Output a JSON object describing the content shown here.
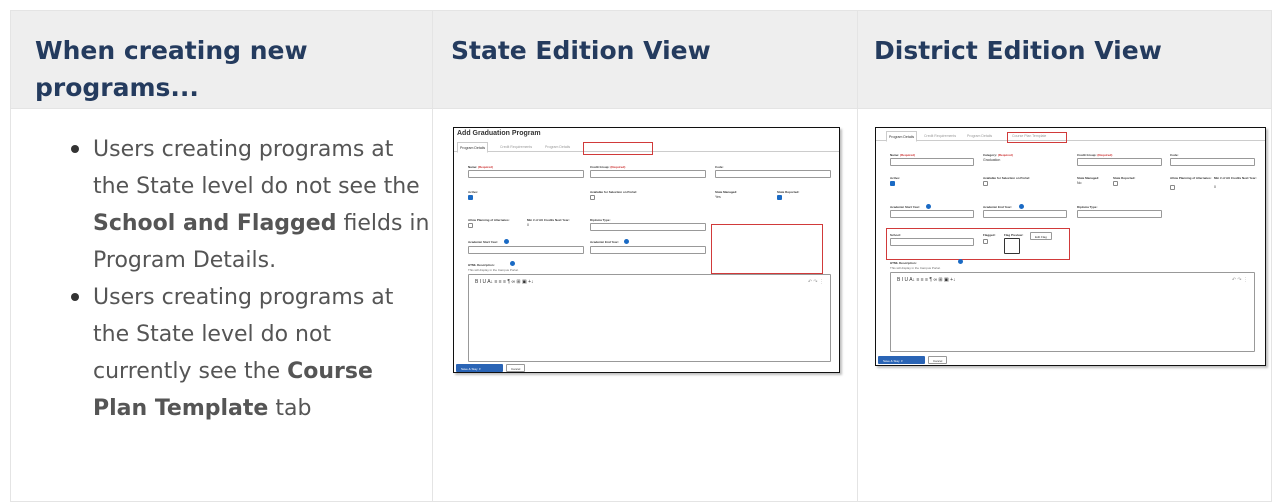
{
  "headers": {
    "col1": "When creating new programs...",
    "col2": "State Edition View",
    "col3": "District Edition View"
  },
  "bullets": [
    {
      "before": "Users creating programs at the State level do not see the ",
      "bold": "School and Flagged",
      "after": " fields in Program Details."
    },
    {
      "before": "Users creating programs at the State level do not currently see the ",
      "bold": "Course Plan Template",
      "after": " tab"
    }
  ],
  "state_shot": {
    "title": "Add Graduation Program",
    "tabs": [
      "Program Details",
      "Credit Requirements",
      "Program Details"
    ],
    "required": "(Required)",
    "name_label": "Name:",
    "credit_group_label": "Credit Group:",
    "code_label": "Code:",
    "active_label": "Active:",
    "available_label": "Available for Selection on Portal:",
    "state_managed_label": "State Managed:",
    "state_managed_value": "Yes",
    "state_reported_label": "State Reported:",
    "allow_planning_label": "Allow Planning of Alternates:",
    "min_credits_label": "Min # of Alt Credits Next Year:",
    "min_credits_value": "0",
    "diploma_type_label": "Diploma Type:",
    "start_year_label": "Academic Start Year:",
    "end_year_label": "Academic End Year:",
    "html_desc_label": "HTML Description:",
    "html_desc_note": "This will display in the Campus Portal.",
    "toolbar": "B   I   U   A↓    ≡  ≡  ≡  ¶    ∞  ⊞  ▣  +↓",
    "undo": "↶  ↷  ⋮",
    "save_label": "Save & Stay",
    "cancel_label": "Cancel"
  },
  "district_shot": {
    "tabs": [
      "Program Details",
      "Credit Requirements",
      "Program Details",
      "Course Plan Template"
    ],
    "required": "(Required)",
    "name_label": "Name:",
    "category_label": "Category:",
    "category_value": "Graduation",
    "credit_group_label": "Credit Group:",
    "code_label": "Code:",
    "active_label": "Active:",
    "available_label": "Available for Selection on Portal:",
    "state_managed_label": "State Managed:",
    "state_managed_value": "No",
    "state_reported_label": "State Reported:",
    "allow_planning_label": "Allow Planning of Alternates:",
    "min_credits_label": "Min # of Alt Credits Next Year:",
    "min_credits_value": "0",
    "start_year_label": "Academic Start Year:",
    "end_year_label": "Academic End Year:",
    "diploma_type_label": "Diploma Type:",
    "school_label": "School:",
    "flagged_label": "Flagged:",
    "flag_preview_label": "Flag Preview:",
    "edit_flag_label": "Edit Flag",
    "html_desc_label": "HTML Description:",
    "html_desc_note": "This will display in the Campus Portal.",
    "toolbar": "B   I   U   A↓    ≡  ≡  ≡  ¶    ∞  ⊞  ▣  +↓",
    "undo": "↶  ↷  ⋮",
    "save_label": "Save & Stay",
    "cancel_label": "Cancel"
  }
}
